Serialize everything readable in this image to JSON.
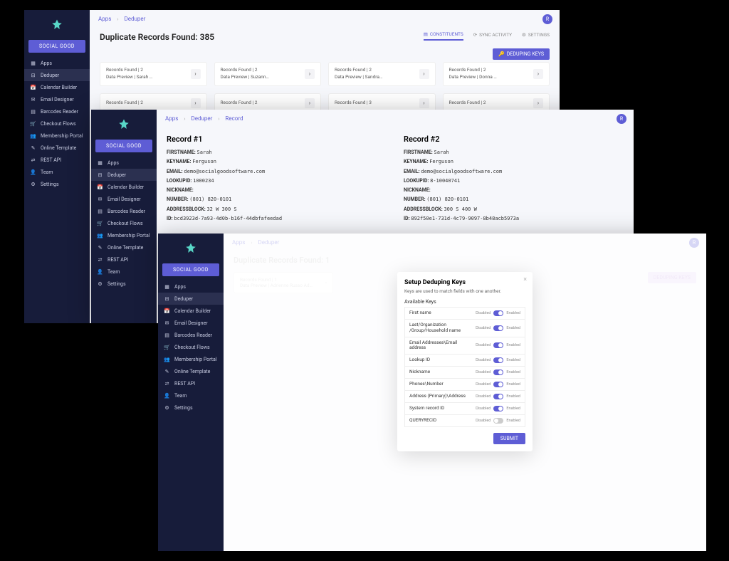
{
  "brand_label": "SOCIAL GOOD",
  "avatar_initial": "R",
  "nav_items": [
    "Apps",
    "Deduper",
    "Calendar Builder",
    "Email Designer",
    "Barcodes Reader",
    "Checkout Flows",
    "Membership Portal",
    "Online Template",
    "REST API",
    "Team",
    "Settings"
  ],
  "layer1": {
    "crumbs": [
      "Apps",
      "Deduper"
    ],
    "heading": "Duplicate Records Found: 385",
    "tabs": {
      "constituents": "CONSTITUENTS",
      "sync": "SYNC ACTIVITY",
      "settings": "SETTINGS"
    },
    "keys_btn": "DEDUPING KEYS",
    "active_nav_index": 1,
    "cards": [
      {
        "line1": "Records Found | 2",
        "line2": "Data Preview | Sarah …"
      },
      {
        "line1": "Records Found | 2",
        "line2": "Data Preview | Suzann…"
      },
      {
        "line1": "Records Found | 2",
        "line2": "Data Preview | Sandra…"
      },
      {
        "line1": "Records Found | 2",
        "line2": "Data Preview | Donna …"
      },
      {
        "line1": "Records Found | 2",
        "line2": ""
      },
      {
        "line1": "Records Found | 2",
        "line2": ""
      },
      {
        "line1": "Records Found | 3",
        "line2": ""
      },
      {
        "line1": "Records Found | 2",
        "line2": ""
      }
    ]
  },
  "layer2": {
    "crumbs": [
      "Apps",
      "Deduper",
      "Record"
    ],
    "active_nav_index": 1,
    "records": [
      {
        "title": "Record #1",
        "fields": [
          [
            "FIRSTNAME",
            "Sarah"
          ],
          [
            "KEYNAME",
            "Ferguson"
          ],
          [
            "EMAIL",
            "demo@socialgoodsoftware.com"
          ],
          [
            "LOOKUPID",
            "1000234"
          ],
          [
            "NICKNAME",
            ""
          ],
          [
            "NUMBER",
            "(801) 820-0101"
          ],
          [
            "ADDRESSBLOCK",
            "32 W 300 S"
          ],
          [
            "ID",
            "bcd3923d-7a93-4d0b-b16f-44dbfafeedad"
          ]
        ]
      },
      {
        "title": "Record #2",
        "fields": [
          [
            "FIRSTNAME",
            "Sarah"
          ],
          [
            "KEYNAME",
            "Ferguson"
          ],
          [
            "EMAIL",
            "demo@socialgoodsoftware.com"
          ],
          [
            "LOOKUPID",
            "8-10040741"
          ],
          [
            "NICKNAME",
            ""
          ],
          [
            "NUMBER",
            "(801) 820-0101"
          ],
          [
            "ADDRESSBLOCK",
            "300 S 400 W"
          ],
          [
            "ID",
            "892f50e1-731d-4c79-9097-8b48acb5973a"
          ]
        ]
      }
    ]
  },
  "layer3": {
    "crumbs": [
      "Apps",
      "Deduper"
    ],
    "active_nav_index": 1,
    "faded_heading": "Duplicate Records Found: 1",
    "faded_card": {
      "l1": "Records Found | 1",
      "l2": "Data Preview | Adrienne Russo Ad…"
    },
    "faded_keys": "DEDUPING KEYS",
    "modal": {
      "title": "Setup Deduping Keys",
      "subtitle": "Keys are used to match fields with one another.",
      "section": "Available Keys",
      "submit": "SUBMIT",
      "labels": {
        "disabled": "Disabled",
        "enabled": "Enabled"
      },
      "keys": [
        {
          "name": "First name",
          "on": true
        },
        {
          "name": "Last/Organization /Group/Household name",
          "on": true
        },
        {
          "name": "Email Addresses\\Email address",
          "on": true
        },
        {
          "name": "Lookup ID",
          "on": true
        },
        {
          "name": "Nickname",
          "on": true
        },
        {
          "name": "Phones\\Number",
          "on": true
        },
        {
          "name": "Address (Primary)\\Address",
          "on": true
        },
        {
          "name": "System record ID",
          "on": true
        },
        {
          "name": "QUERYRECID",
          "on": false
        }
      ]
    }
  }
}
